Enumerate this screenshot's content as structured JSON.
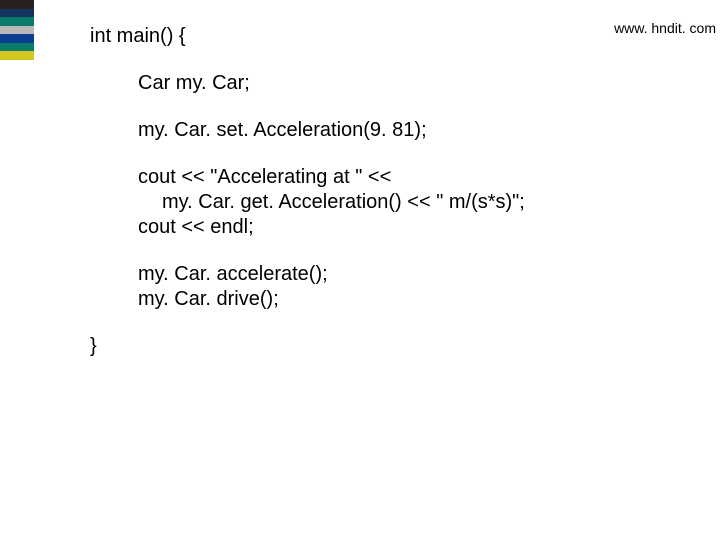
{
  "header": {
    "url": "www. hndit. com"
  },
  "code": {
    "l1": "int main() {",
    "l2": "Car my. Car;",
    "l3": "my. Car. set. Acceleration(9. 81);",
    "l4": "cout << \"Accelerating at \" <<",
    "l5": "my. Car. get. Acceleration() << \" m/(s*s)\";",
    "l6": "cout << endl;",
    "l7": "my. Car. accelerate();",
    "l8": "my. Car. drive();",
    "l9": "}"
  }
}
